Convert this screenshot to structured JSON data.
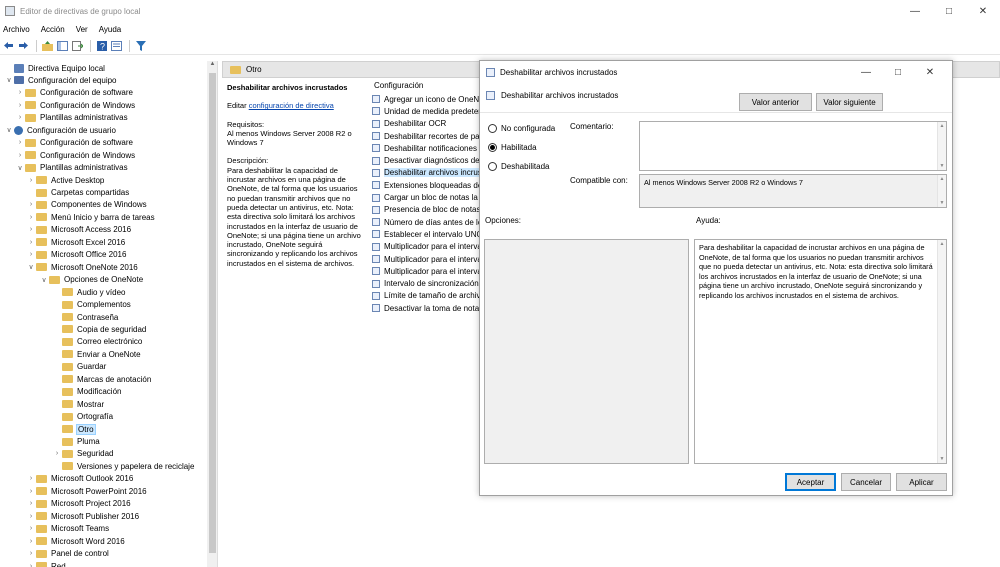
{
  "window": {
    "title": "Editor de directivas de grupo local"
  },
  "menu": [
    "Archivo",
    "Acción",
    "Ver",
    "Ayuda"
  ],
  "toolbar": {
    "icons": [
      "back-arrow-icon",
      "forward-arrow-icon",
      "up-folder-icon",
      "show-tree-icon",
      "export-list-icon",
      "help-icon",
      "properties-icon",
      "filter-icon"
    ]
  },
  "tree": [
    {
      "label": "Directiva Equipo local",
      "level": 0,
      "expander": "",
      "icon": "policy"
    },
    {
      "label": "Configuración del equipo",
      "level": 1,
      "expander": "v",
      "icon": "computer"
    },
    {
      "label": "Configuración de software",
      "level": 2,
      "expander": ">",
      "icon": "folder"
    },
    {
      "label": "Configuración de Windows",
      "level": 2,
      "expander": ">",
      "icon": "folder"
    },
    {
      "label": "Plantillas administrativas",
      "level": 2,
      "expander": ">",
      "icon": "folder"
    },
    {
      "label": "Configuración de usuario",
      "level": 1,
      "expander": "v",
      "icon": "user"
    },
    {
      "label": "Configuración de software",
      "level": 2,
      "expander": ">",
      "icon": "folder"
    },
    {
      "label": "Configuración de Windows",
      "level": 2,
      "expander": ">",
      "icon": "folder"
    },
    {
      "label": "Plantillas administrativas",
      "level": 2,
      "expander": "v",
      "icon": "folder"
    },
    {
      "label": "Active Desktop",
      "level": 3,
      "expander": ">",
      "icon": "folder"
    },
    {
      "label": "Carpetas compartidas",
      "level": 3,
      "expander": "",
      "icon": "folder"
    },
    {
      "label": "Componentes de Windows",
      "level": 3,
      "expander": ">",
      "icon": "folder"
    },
    {
      "label": "Menú Inicio y barra de tareas",
      "level": 3,
      "expander": ">",
      "icon": "folder"
    },
    {
      "label": "Microsoft Access 2016",
      "level": 3,
      "expander": ">",
      "icon": "folder"
    },
    {
      "label": "Microsoft Excel 2016",
      "level": 3,
      "expander": ">",
      "icon": "folder"
    },
    {
      "label": "Microsoft Office 2016",
      "level": 3,
      "expander": ">",
      "icon": "folder"
    },
    {
      "label": "Microsoft OneNote 2016",
      "level": 3,
      "expander": "v",
      "icon": "folder"
    },
    {
      "label": "Opciones de OneNote",
      "level": 4,
      "expander": "v",
      "icon": "folder"
    },
    {
      "label": "Audio y vídeo",
      "level": 5,
      "expander": "",
      "icon": "folder"
    },
    {
      "label": "Complementos",
      "level": 5,
      "expander": "",
      "icon": "folder"
    },
    {
      "label": "Contraseña",
      "level": 5,
      "expander": "",
      "icon": "folder"
    },
    {
      "label": "Copia de seguridad",
      "level": 5,
      "expander": "",
      "icon": "folder"
    },
    {
      "label": "Correo electrónico",
      "level": 5,
      "expander": "",
      "icon": "folder"
    },
    {
      "label": "Enviar a OneNote",
      "level": 5,
      "expander": "",
      "icon": "folder"
    },
    {
      "label": "Guardar",
      "level": 5,
      "expander": "",
      "icon": "folder"
    },
    {
      "label": "Marcas de anotación",
      "level": 5,
      "expander": "",
      "icon": "folder"
    },
    {
      "label": "Modificación",
      "level": 5,
      "expander": "",
      "icon": "folder"
    },
    {
      "label": "Mostrar",
      "level": 5,
      "expander": "",
      "icon": "folder"
    },
    {
      "label": "Ortografía",
      "level": 5,
      "expander": "",
      "icon": "folder"
    },
    {
      "label": "Otro",
      "level": 5,
      "expander": "",
      "icon": "folder",
      "selected": true
    },
    {
      "label": "Pluma",
      "level": 5,
      "expander": "",
      "icon": "folder"
    },
    {
      "label": "Seguridad",
      "level": 5,
      "expander": ">",
      "icon": "folder"
    },
    {
      "label": "Versiones y papelera de reciclaje",
      "level": 5,
      "expander": "",
      "icon": "folder"
    },
    {
      "label": "Microsoft Outlook 2016",
      "level": 3,
      "expander": ">",
      "icon": "folder"
    },
    {
      "label": "Microsoft PowerPoint 2016",
      "level": 3,
      "expander": ">",
      "icon": "folder"
    },
    {
      "label": "Microsoft Project 2016",
      "level": 3,
      "expander": ">",
      "icon": "folder"
    },
    {
      "label": "Microsoft Publisher 2016",
      "level": 3,
      "expander": ">",
      "icon": "folder"
    },
    {
      "label": "Microsoft Teams",
      "level": 3,
      "expander": ">",
      "icon": "folder"
    },
    {
      "label": "Microsoft Word 2016",
      "level": 3,
      "expander": ">",
      "icon": "folder"
    },
    {
      "label": "Panel de control",
      "level": 3,
      "expander": ">",
      "icon": "folder"
    },
    {
      "label": "Red",
      "level": 3,
      "expander": ">",
      "icon": "folder"
    }
  ],
  "content": {
    "header": "Otro",
    "desc": {
      "title": "Deshabilitar archivos incrustados",
      "edit_prefix": "Editar",
      "edit_link": "configuración de directiva",
      "req_label": "Requisitos:",
      "req_text": "Al menos Windows Server 2008 R2 o Windows 7",
      "desc_label": "Descripción:",
      "desc_text": "Para deshabilitar la capacidad de incrustar archivos en una página de OneNote, de tal forma que los usuarios no puedan transmitir archivos que no pueda detectar un antivirus, etc. Nota: esta directiva solo limitará los archivos incrustados en la interfaz de usuario de OneNote; si una página tiene un archivo incrustado, OneNote seguirá sincronizando y replicando los archivos incrustados en el sistema de archivos."
    },
    "settings_header": "Configuración",
    "settings": [
      "Agregar un icono de OneNote",
      "Unidad de medida predeterminada",
      "Deshabilitar OCR",
      "Deshabilitar recortes de pantalla",
      "Deshabilitar notificaciones",
      "Desactivar diagnósticos de OneNote",
      "Deshabilitar archivos incrustados",
      "Extensiones bloqueadas de archivos incrustados",
      "Cargar un bloc de notas la primera vez",
      "Presencia de bloc de notas",
      "Número de días antes de los informes",
      "Establecer el intervalo UNC",
      "Multiplicador para el intervalo",
      "Multiplicador para el intervalo",
      "Multiplicador para el intervalo",
      "Intervalo de sincronización",
      "Límite de tamaño de archivo",
      "Desactivar la toma de notas"
    ],
    "settings_selected": 6
  },
  "dialog": {
    "title": "Deshabilitar archivos incrustados",
    "policy_name": "Deshabilitar archivos incrustados",
    "prev_button": "Valor anterior",
    "next_button": "Valor siguiente",
    "radios": [
      {
        "label": "No configurada",
        "checked": false
      },
      {
        "label": "Habilitada",
        "checked": true
      },
      {
        "label": "Deshabilitada",
        "checked": false
      }
    ],
    "comment_label": "Comentario:",
    "comment_value": "",
    "compatible_label": "Compatible con:",
    "compatible_value": "Al menos Windows Server 2008 R2 o Windows 7",
    "options_label": "Opciones:",
    "help_label": "Ayuda:",
    "help_text": "Para deshabilitar la capacidad de incrustar archivos en una página de OneNote, de tal forma que los usuarios no puedan transmitir archivos que no pueda detectar un antivirus, etc. Nota: esta directiva solo limitará los archivos incrustados en la interfaz de usuario de OneNote; si una página tiene un archivo incrustado, OneNote seguirá sincronizando y replicando los archivos incrustados en el sistema de archivos.",
    "ok_button": "Aceptar",
    "cancel_button": "Cancelar",
    "apply_button": "Aplicar"
  }
}
